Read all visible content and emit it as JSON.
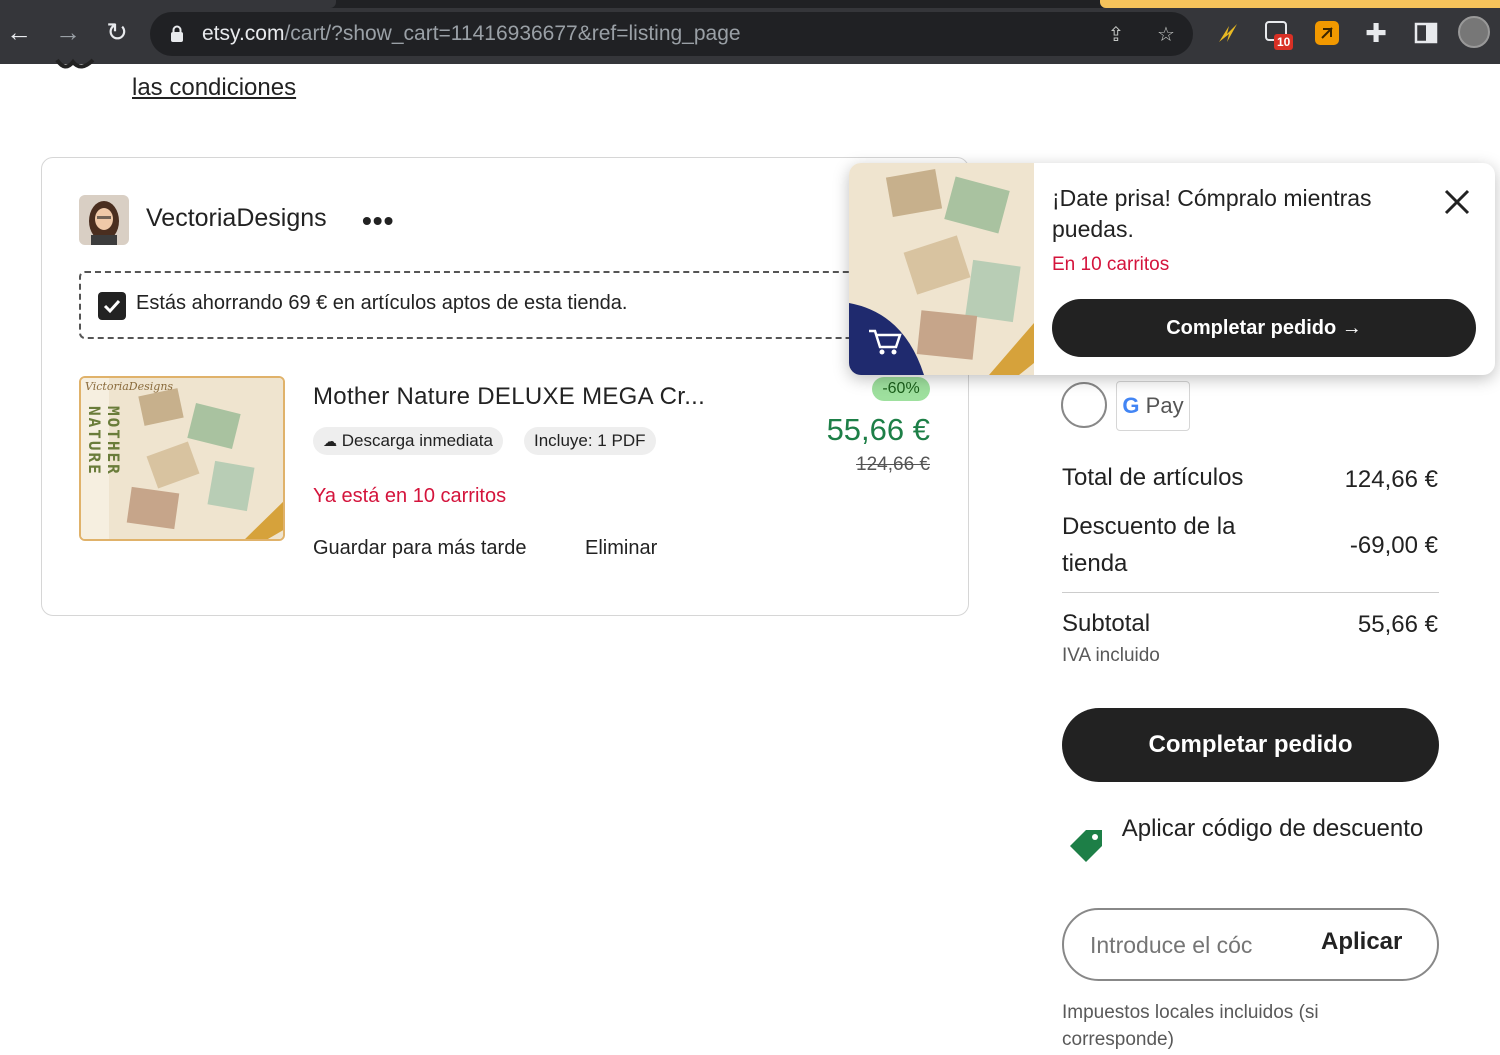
{
  "browser": {
    "url_domain": "etsy.com",
    "url_path": "/cart/?show_cart=11416936677&ref=listing_page",
    "extension_badge": "10"
  },
  "page": {
    "top_link": "las condiciones"
  },
  "shop": {
    "name": "VectoriaDesigns",
    "more_label": "•••",
    "savings_text": "Estás ahorrando 69 € en artículos aptos de esta tienda."
  },
  "item": {
    "title": "Mother Nature DELUXE MEGA Cr...",
    "badges": [
      "Descarga inmediata",
      "Incluye: 1 PDF"
    ],
    "in_carts": "Ya está en 10 carritos",
    "save_later": "Guardar para más tarde",
    "remove": "Eliminar",
    "discount": "-60%",
    "price": "55,66 €",
    "original_price": "124,66 €",
    "image_text_vertical": "MOTHER NATURE",
    "image_brand": "VictoriaDesigns"
  },
  "summary": {
    "gpay_label": "Pay",
    "items_total_label": "Total de artículos",
    "items_total_value": "124,66 €",
    "shop_discount_label": "Descuento de la tienda",
    "shop_discount_value": "-69,00 €",
    "subtotal_label": "Subtotal",
    "subtotal_value": "55,66 €",
    "vat_note": "IVA incluido",
    "complete_button": "Completar pedido",
    "coupon_link": "Aplicar código de descuento",
    "coupon_placeholder": "Introduce el cóc",
    "coupon_apply": "Aplicar",
    "tax_note": "Impuestos locales incluidos (si corresponde)"
  },
  "popup": {
    "title": "¡Date prisa! Cómpralo mientras puedas.",
    "subtitle": "En 10 carritos",
    "button": "Completar pedido",
    "button_arrow": "→"
  },
  "colors": {
    "accent_red": "#d4143c",
    "price_green": "#1d7f47",
    "primary_dark": "#222222",
    "popup_cart_bg": "#1f2a6e",
    "tag_green": "#1d7f47"
  }
}
